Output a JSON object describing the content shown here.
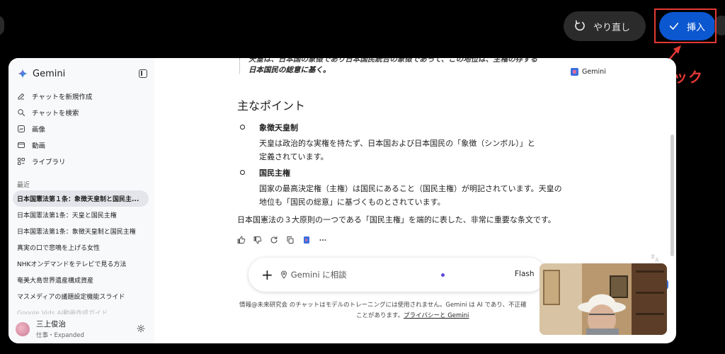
{
  "toolbar": {
    "redo_label": "やり直し",
    "insert_label": "挿入",
    "annotation": "ここをクリック"
  },
  "sidebar": {
    "title": "Gemini",
    "nav": [
      {
        "label": "チャットを新規作成",
        "icon": "edit-icon"
      },
      {
        "label": "チャットを検索",
        "icon": "search-icon"
      },
      {
        "label": "画像",
        "icon": "image-icon"
      },
      {
        "label": "動画",
        "icon": "video-icon"
      },
      {
        "label": "ライブラリ",
        "icon": "library-icon"
      }
    ],
    "recent_label": "最近",
    "recent": [
      "日本国憲法第１条：象徴天皇制と国民主...",
      "日本国憲法第1条：天皇と国民主権",
      "日本国憲法第1条：象徴天皇制と国民主権",
      "真実の口で悲鳴を上げる女性",
      "NHKオンデマンドをテレビで見る方法",
      "奄美大島世界遺産構成資産",
      "マスメディアの議題設定機能スライド",
      "Google Vids AI動画作成ガイド"
    ],
    "user_name": "三上俊治",
    "user_sub": "仕事・Expanded"
  },
  "content": {
    "quote_top": "天皇は、日本国の象徴であり日本国民統合の象徴であって、この地位は、主権の存する",
    "quote_bottom": "日本国民の総意に基く。",
    "share_label": "Gemini",
    "section_title": "主なポイント",
    "points": [
      {
        "title": "象徴天皇制",
        "line1": "天皇は政治的な実権を持たず、日本国および日本国民の「象徴（シンボル）」と",
        "line2": "定義されています。"
      },
      {
        "title": "国民主権",
        "line1": "国家の最高決定権（主権）は国民にあること（国民主権）が明記されています。天皇の",
        "line2": "地位も「国民の総意」に基づくものとされています。"
      }
    ],
    "summary": "日本国憲法の３大原則の一つである「国民主権」を端的に表した、非常に重要な条文です。"
  },
  "input": {
    "placeholder": "Gemini に相談",
    "model": "Flash"
  },
  "disclaimer": {
    "line1": "情報@未来研究会 のチャットはモデルのトレーニングには使用されません。Gemini は AI であり、不正確",
    "line2_prefix": "ことがあります。",
    "line2_link": "プライバシーと Gemini"
  },
  "colors": {
    "accent_blue": "#0b57d0",
    "annotation_red": "#e53935"
  }
}
